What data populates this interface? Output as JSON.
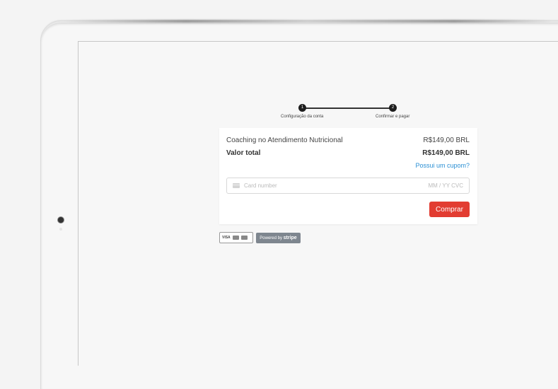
{
  "steps": [
    {
      "number": "1",
      "label": "Configuração da conta"
    },
    {
      "number": "2",
      "label": "Confirmar e pagar"
    }
  ],
  "order": {
    "item_name": "Coaching no Atendimento Nutricional",
    "item_price": "R$149,00 BRL",
    "total_label": "Valor total",
    "total_price": "R$149,00 BRL",
    "coupon_link": "Possui um cupom?"
  },
  "payment": {
    "card_placeholder": "Card number",
    "card_right_placeholder": "MM / YY  CVC",
    "buy_label": "Comprar"
  },
  "badges": {
    "cards_text": "VISA",
    "powered_by": "Powered by",
    "stripe": "stripe"
  },
  "colors": {
    "buy_button": "#e23c31",
    "link": "#2a8fd4",
    "stripe_badge": "#7e868f"
  }
}
